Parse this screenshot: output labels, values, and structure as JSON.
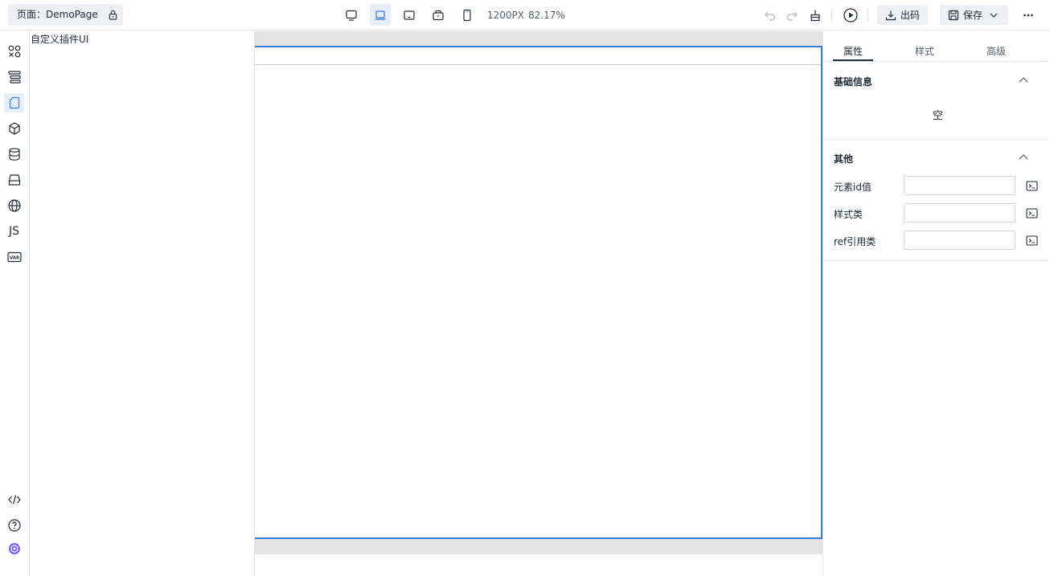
{
  "topbar": {
    "page_label": "页面：DemoPage",
    "canvas_size": "1200PX",
    "canvas_zoom": "82.17%",
    "export_label": "出码",
    "save_label": "保存"
  },
  "plugin_panel": {
    "title": "自定义插件UI"
  },
  "rail": {
    "js_label": "JS",
    "var_label": "VAR"
  },
  "properties": {
    "tabs": [
      {
        "label": "属性",
        "active": true
      },
      {
        "label": "样式",
        "active": false
      },
      {
        "label": "高级",
        "active": false
      }
    ],
    "basic_section": {
      "title": "基础信息",
      "empty_text": "空"
    },
    "other_section": {
      "title": "其他",
      "fields": [
        {
          "label": "元素id值",
          "value": ""
        },
        {
          "label": "样式类",
          "value": ""
        },
        {
          "label": "ref引用类",
          "value": ""
        }
      ]
    }
  },
  "colors": {
    "accent": "#3b7ddd",
    "active_bg": "#e6eefb"
  }
}
